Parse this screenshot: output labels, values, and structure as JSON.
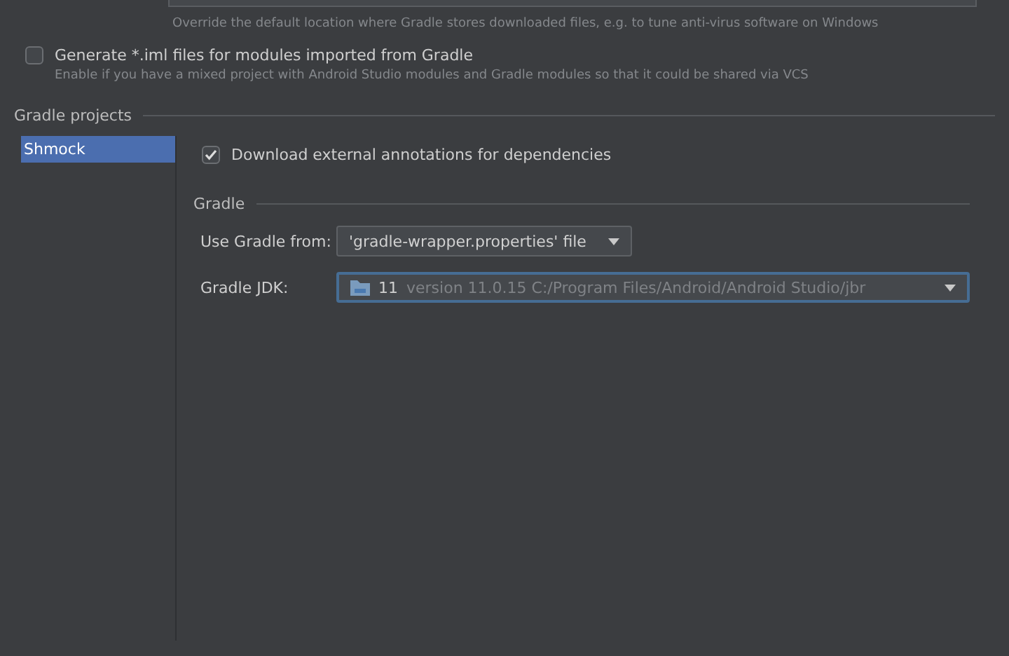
{
  "location_hint": "Override the default location where Gradle stores downloaded files, e.g. to tune anti-virus software on Windows",
  "generate_iml": {
    "label": "Generate *.iml files for modules imported from Gradle",
    "checked": false,
    "hint": "Enable if you have a mixed project with Android Studio modules and Gradle modules so that it could be shared via VCS"
  },
  "gradle_projects": {
    "title": "Gradle projects",
    "items": [
      {
        "label": "Shmock",
        "selected": true
      }
    ]
  },
  "download_annotations": {
    "label": "Download external annotations for dependencies",
    "checked": true
  },
  "gradle_section": {
    "title": "Gradle",
    "use_gradle_from": {
      "label": "Use Gradle from:",
      "value": "'gradle-wrapper.properties' file"
    },
    "gradle_jdk": {
      "label": "Gradle JDK:",
      "version": "11",
      "detail": "version 11.0.15 C:/Program Files/Android/Android Studio/jbr",
      "focused": true
    }
  }
}
